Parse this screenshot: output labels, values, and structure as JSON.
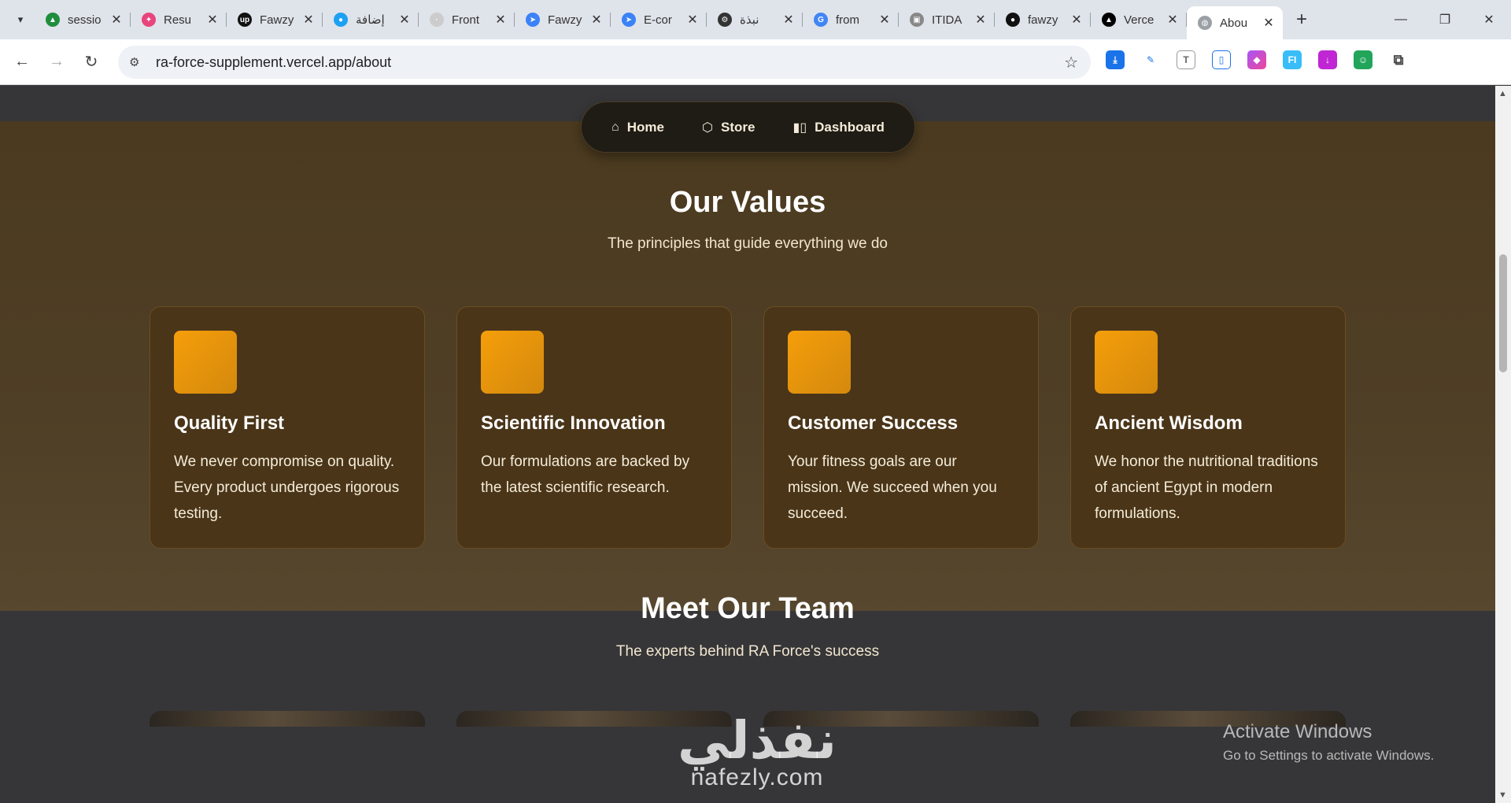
{
  "browser": {
    "tabs": [
      {
        "title": "sessio",
        "fav_color": "#1e8e3e",
        "glyph": "▲"
      },
      {
        "title": "Resu",
        "fav_color": "#e8457c",
        "glyph": "✦"
      },
      {
        "title": "Fawzy",
        "fav_color": "#111111",
        "glyph": "up"
      },
      {
        "title": "إضافة",
        "fav_color": "#1da1f2",
        "glyph": "●"
      },
      {
        "title": "Front",
        "fav_color": "#cccccc",
        "glyph": "·"
      },
      {
        "title": "Fawzy",
        "fav_color": "#3b82f6",
        "glyph": "➤"
      },
      {
        "title": "E-cor",
        "fav_color": "#3b82f6",
        "glyph": "➤"
      },
      {
        "title": "نبذة",
        "fav_color": "#333333",
        "glyph": "⚙"
      },
      {
        "title": "from",
        "fav_color": "#4285f4",
        "glyph": "G"
      },
      {
        "title": "ITIDA",
        "fav_color": "#888888",
        "glyph": "▣"
      },
      {
        "title": "fawzy",
        "fav_color": "#111111",
        "glyph": "●"
      },
      {
        "title": "Verce",
        "fav_color": "#000000",
        "glyph": "▲"
      },
      {
        "title": "Abou",
        "fav_color": "#9aa0a6",
        "glyph": "◍",
        "active": true
      }
    ],
    "new_tab": "+",
    "tab_close": "✕",
    "url": "ra-force-supplement.vercel.app/about"
  },
  "nav": {
    "home": "Home",
    "store": "Store",
    "dashboard": "Dashboard"
  },
  "values": {
    "title": "Our Values",
    "subtitle": "The principles that guide everything we do",
    "cards": [
      {
        "title": "Quality First",
        "text": "We never compromise on quality. Every product undergoes rigorous testing."
      },
      {
        "title": "Scientific Innovation",
        "text": "Our formulations are backed by the latest scientific research."
      },
      {
        "title": "Customer Success",
        "text": "Your fitness goals are our mission. We succeed when you succeed."
      },
      {
        "title": "Ancient Wisdom",
        "text": "We honor the nutritional traditions of ancient Egypt in modern formulations."
      }
    ]
  },
  "team": {
    "title": "Meet Our Team",
    "subtitle": "The experts behind RA Force's success"
  },
  "os_overlay": {
    "line1": "Activate Windows",
    "line2": "Go to Settings to activate Windows."
  },
  "watermark": {
    "arabic": "نفذلي",
    "latin": "nafezly.com"
  }
}
